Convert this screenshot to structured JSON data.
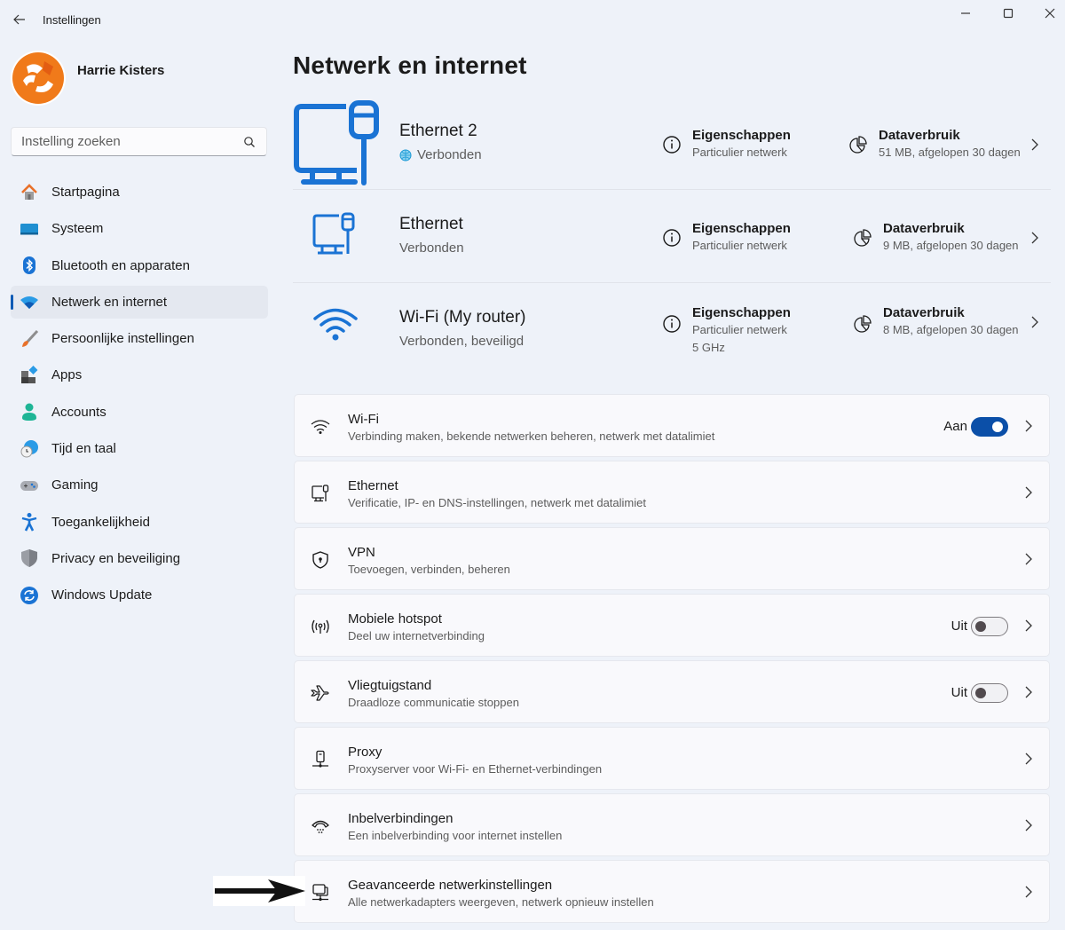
{
  "window": {
    "title": "Instellingen",
    "controls": {
      "minimize": "minimize",
      "maximize": "maximize",
      "close": "close"
    }
  },
  "profile": {
    "name": "Harrie Kisters"
  },
  "search": {
    "placeholder": "Instelling zoeken",
    "value": ""
  },
  "sidebar": {
    "items": [
      {
        "label": "Startpagina",
        "icon": "home-icon",
        "active": false
      },
      {
        "label": "Systeem",
        "icon": "system-icon",
        "active": false
      },
      {
        "label": "Bluetooth en apparaten",
        "icon": "bluetooth-icon",
        "active": false
      },
      {
        "label": "Netwerk en internet",
        "icon": "wifi-icon",
        "active": true
      },
      {
        "label": "Persoonlijke instellingen",
        "icon": "brush-icon",
        "active": false
      },
      {
        "label": "Apps",
        "icon": "apps-icon",
        "active": false
      },
      {
        "label": "Accounts",
        "icon": "account-icon",
        "active": false
      },
      {
        "label": "Tijd en taal",
        "icon": "time-language-icon",
        "active": false
      },
      {
        "label": "Gaming",
        "icon": "gamepad-icon",
        "active": false
      },
      {
        "label": "Toegankelijkheid",
        "icon": "accessibility-icon",
        "active": false
      },
      {
        "label": "Privacy en beveiliging",
        "icon": "shield-icon",
        "active": false
      },
      {
        "label": "Windows Update",
        "icon": "update-icon",
        "active": false
      }
    ]
  },
  "main": {
    "title": "Netwerk en internet",
    "connections": [
      {
        "name": "Ethernet 2",
        "status": "Verbonden",
        "status_icon": "globe-icon",
        "properties_title": "Eigenschappen",
        "properties_sub": "Particulier netwerk",
        "properties_extra": "",
        "usage_title": "Dataverbruik",
        "usage_sub": "51 MB, afgelopen 30 dagen"
      },
      {
        "name": "Ethernet",
        "status": "Verbonden",
        "properties_title": "Eigenschappen",
        "properties_sub": "Particulier netwerk",
        "properties_extra": "",
        "usage_title": "Dataverbruik",
        "usage_sub": "9 MB, afgelopen 30 dagen"
      },
      {
        "name": "Wi-Fi (My router)",
        "status": "Verbonden, beveiligd",
        "properties_title": "Eigenschappen",
        "properties_sub": "Particulier netwerk",
        "properties_extra": "5 GHz",
        "usage_title": "Dataverbruik",
        "usage_sub": "8 MB, afgelopen 30 dagen"
      }
    ],
    "cards": [
      {
        "title": "Wi-Fi",
        "sub": "Verbinding maken, bekende netwerken beheren, netwerk met datalimiet",
        "icon": "wifi-icon",
        "toggle": true,
        "toggle_label": "Aan"
      },
      {
        "title": "Ethernet",
        "sub": "Verificatie, IP- en DNS-instellingen, netwerk met datalimiet",
        "icon": "ethernet-icon"
      },
      {
        "title": "VPN",
        "sub": "Toevoegen, verbinden, beheren",
        "icon": "vpn-shield-icon"
      },
      {
        "title": "Mobiele hotspot",
        "sub": "Deel uw internetverbinding",
        "icon": "hotspot-icon",
        "toggle": false,
        "toggle_label": "Uit"
      },
      {
        "title": "Vliegtuigstand",
        "sub": "Draadloze communicatie stoppen",
        "icon": "airplane-icon",
        "toggle": false,
        "toggle_label": "Uit"
      },
      {
        "title": "Proxy",
        "sub": "Proxyserver voor Wi-Fi- en Ethernet-verbindingen",
        "icon": "proxy-icon"
      },
      {
        "title": "Inbelverbindingen",
        "sub": "Een inbelverbinding voor internet instellen",
        "icon": "dialup-icon"
      },
      {
        "title": "Geavanceerde netwerkinstellingen",
        "sub": "Alle netwerkadapters weergeven, netwerk opnieuw instellen",
        "icon": "advanced-network-icon"
      }
    ]
  },
  "colors": {
    "accent": "#0f5bb5",
    "icon_blue": "#1a73d4",
    "toggle_on": "#0b4fa8",
    "background": "#eef2f9",
    "card": "#f9f9fc"
  }
}
